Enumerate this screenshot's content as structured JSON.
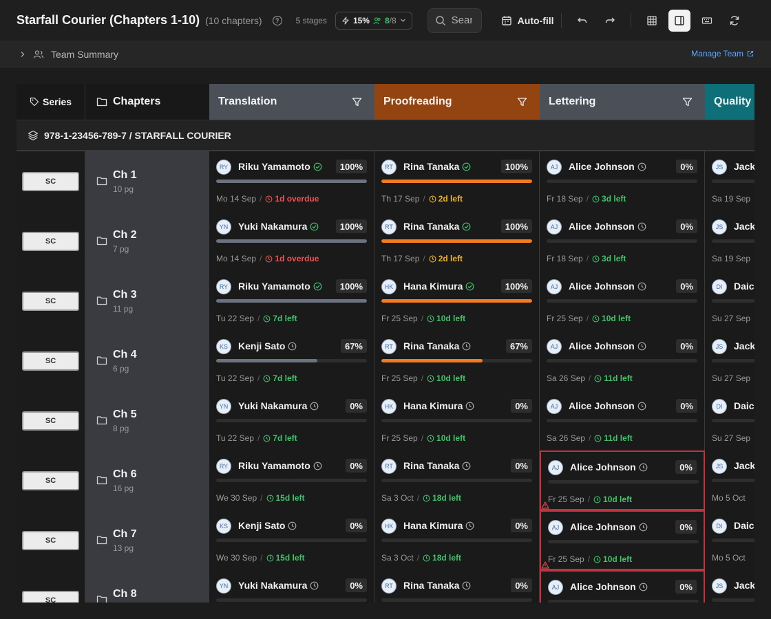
{
  "header": {
    "title": "Starfall Courier (Chapters 1-10)",
    "chapter_count": "(10 chapters)",
    "stages": "5 stages",
    "progress_pct": "15%",
    "team_active": "8",
    "team_total": "/8",
    "search_placeholder": "Search",
    "autofill_label": "Auto-fill"
  },
  "summary": {
    "label": "Team Summary",
    "manage_link": "Manage Team"
  },
  "columns": {
    "series": "Series",
    "chapters": "Chapters",
    "stages": [
      "Translation",
      "Proofreading",
      "Lettering",
      "Quality"
    ]
  },
  "group": {
    "label": "978-1-23456-789-7 / STARFALL COURIER"
  },
  "colors": {
    "translation": "#4b4f57",
    "proofreading": "#934411",
    "lettering": "#4b4f57",
    "quality": "#0f6f78",
    "overdue": "#ef5350",
    "soon": "#f0b429",
    "ok": "#3fc46a",
    "link": "#5aa8ff"
  },
  "rows": [
    {
      "series": "SC",
      "chapter": "Ch 1",
      "pages": "10 pg",
      "tasks": [
        {
          "initials": "RY",
          "name": "Riku Yamamoto",
          "status": "done",
          "pct": "100%",
          "fill": 1.0,
          "date": "Mo 14 Sep",
          "due": "1d overdue",
          "due_level": "red"
        },
        {
          "initials": "RT",
          "name": "Rina Tanaka",
          "status": "done",
          "pct": "100%",
          "fill": 1.0,
          "date": "Th 17 Sep",
          "due": "2d left",
          "due_level": "amber"
        },
        {
          "initials": "AJ",
          "name": "Alice Johnson",
          "status": "pending",
          "pct": "0%",
          "fill": 0,
          "date": "Fr 18 Sep",
          "due": "3d left",
          "due_level": "green"
        },
        {
          "initials": "JS",
          "name": "Jack",
          "status": "pending",
          "pct": "",
          "fill": 0,
          "date": "Sa 19 Sep",
          "due": "",
          "due_level": "green"
        }
      ]
    },
    {
      "series": "SC",
      "chapter": "Ch 2",
      "pages": "7 pg",
      "tasks": [
        {
          "initials": "YN",
          "name": "Yuki Nakamura",
          "status": "done",
          "pct": "100%",
          "fill": 1.0,
          "date": "Mo 14 Sep",
          "due": "1d overdue",
          "due_level": "red"
        },
        {
          "initials": "RT",
          "name": "Rina Tanaka",
          "status": "done",
          "pct": "100%",
          "fill": 1.0,
          "date": "Th 17 Sep",
          "due": "2d left",
          "due_level": "amber"
        },
        {
          "initials": "AJ",
          "name": "Alice Johnson",
          "status": "pending",
          "pct": "0%",
          "fill": 0,
          "date": "Fr 18 Sep",
          "due": "3d left",
          "due_level": "green"
        },
        {
          "initials": "JS",
          "name": "Jack",
          "status": "pending",
          "pct": "",
          "fill": 0,
          "date": "Sa 19 Sep",
          "due": "",
          "due_level": "green"
        }
      ]
    },
    {
      "series": "SC",
      "chapter": "Ch 3",
      "pages": "11 pg",
      "tasks": [
        {
          "initials": "RY",
          "name": "Riku Yamamoto",
          "status": "done",
          "pct": "100%",
          "fill": 1.0,
          "date": "Tu 22 Sep",
          "due": "7d left",
          "due_level": "green"
        },
        {
          "initials": "HK",
          "name": "Hana Kimura",
          "status": "done",
          "pct": "100%",
          "fill": 1.0,
          "date": "Fr 25 Sep",
          "due": "10d left",
          "due_level": "green"
        },
        {
          "initials": "AJ",
          "name": "Alice Johnson",
          "status": "pending",
          "pct": "0%",
          "fill": 0,
          "date": "Fr 25 Sep",
          "due": "10d left",
          "due_level": "green"
        },
        {
          "initials": "DI",
          "name": "Daic",
          "status": "pending",
          "pct": "",
          "fill": 0,
          "date": "Su 27 Sep",
          "due": "",
          "due_level": "green"
        }
      ]
    },
    {
      "series": "SC",
      "chapter": "Ch 4",
      "pages": "6 pg",
      "tasks": [
        {
          "initials": "KS",
          "name": "Kenji Sato",
          "status": "pending",
          "pct": "67%",
          "fill": 0.67,
          "date": "Tu 22 Sep",
          "due": "7d left",
          "due_level": "green"
        },
        {
          "initials": "RT",
          "name": "Rina Tanaka",
          "status": "pending",
          "pct": "67%",
          "fill": 0.67,
          "date": "Fr 25 Sep",
          "due": "10d left",
          "due_level": "green"
        },
        {
          "initials": "AJ",
          "name": "Alice Johnson",
          "status": "pending",
          "pct": "0%",
          "fill": 0,
          "date": "Sa 26 Sep",
          "due": "11d left",
          "due_level": "green"
        },
        {
          "initials": "JS",
          "name": "Jack",
          "status": "pending",
          "pct": "",
          "fill": 0,
          "date": "Su 27 Sep",
          "due": "",
          "due_level": "green"
        }
      ]
    },
    {
      "series": "SC",
      "chapter": "Ch 5",
      "pages": "8 pg",
      "tasks": [
        {
          "initials": "YN",
          "name": "Yuki Nakamura",
          "status": "pending",
          "pct": "0%",
          "fill": 0,
          "date": "Tu 22 Sep",
          "due": "7d left",
          "due_level": "green"
        },
        {
          "initials": "HK",
          "name": "Hana Kimura",
          "status": "pending",
          "pct": "0%",
          "fill": 0,
          "date": "Fr 25 Sep",
          "due": "10d left",
          "due_level": "green"
        },
        {
          "initials": "AJ",
          "name": "Alice Johnson",
          "status": "pending",
          "pct": "0%",
          "fill": 0,
          "date": "Sa 26 Sep",
          "due": "11d left",
          "due_level": "green"
        },
        {
          "initials": "DI",
          "name": "Daic",
          "status": "pending",
          "pct": "",
          "fill": 0,
          "date": "Su 27 Sep",
          "due": "",
          "due_level": "green"
        }
      ]
    },
    {
      "series": "SC",
      "chapter": "Ch 6",
      "pages": "16 pg",
      "tasks": [
        {
          "initials": "RY",
          "name": "Riku Yamamoto",
          "status": "pending",
          "pct": "0%",
          "fill": 0,
          "date": "We 30 Sep",
          "due": "15d left",
          "due_level": "green"
        },
        {
          "initials": "RT",
          "name": "Rina Tanaka",
          "status": "pending",
          "pct": "0%",
          "fill": 0,
          "date": "Sa 3 Oct",
          "due": "18d left",
          "due_level": "green"
        },
        {
          "initials": "AJ",
          "name": "Alice Johnson",
          "status": "pending",
          "pct": "0%",
          "fill": 0,
          "date": "Fr 25 Sep",
          "due": "10d left",
          "due_level": "green",
          "flag": true
        },
        {
          "initials": "JS",
          "name": "Jack",
          "status": "pending",
          "pct": "",
          "fill": 0,
          "date": "Mo 5 Oct",
          "due": "",
          "due_level": "green"
        }
      ]
    },
    {
      "series": "SC",
      "chapter": "Ch 7",
      "pages": "13 pg",
      "tasks": [
        {
          "initials": "KS",
          "name": "Kenji Sato",
          "status": "pending",
          "pct": "0%",
          "fill": 0,
          "date": "We 30 Sep",
          "due": "15d left",
          "due_level": "green"
        },
        {
          "initials": "HK",
          "name": "Hana Kimura",
          "status": "pending",
          "pct": "0%",
          "fill": 0,
          "date": "Sa 3 Oct",
          "due": "18d left",
          "due_level": "green"
        },
        {
          "initials": "AJ",
          "name": "Alice Johnson",
          "status": "pending",
          "pct": "0%",
          "fill": 0,
          "date": "Fr 25 Sep",
          "due": "10d left",
          "due_level": "green",
          "flag": true
        },
        {
          "initials": "DI",
          "name": "Daic",
          "status": "pending",
          "pct": "",
          "fill": 0,
          "date": "Mo 5 Oct",
          "due": "",
          "due_level": "green"
        }
      ]
    },
    {
      "series": "SC",
      "chapter": "Ch 8",
      "pages": "",
      "tasks": [
        {
          "initials": "YN",
          "name": "Yuki Nakamura",
          "status": "pending",
          "pct": "0%",
          "fill": 0,
          "date": "",
          "due": "",
          "due_level": "green"
        },
        {
          "initials": "RT",
          "name": "Rina Tanaka",
          "status": "pending",
          "pct": "0%",
          "fill": 0,
          "date": "",
          "due": "",
          "due_level": "green"
        },
        {
          "initials": "AJ",
          "name": "Alice Johnson",
          "status": "pending",
          "pct": "0%",
          "fill": 0,
          "date": "",
          "due": "",
          "due_level": "green",
          "flag": true
        },
        {
          "initials": "JS",
          "name": "Jack",
          "status": "pending",
          "pct": "",
          "fill": 0,
          "date": "",
          "due": "",
          "due_level": "green"
        }
      ]
    }
  ]
}
